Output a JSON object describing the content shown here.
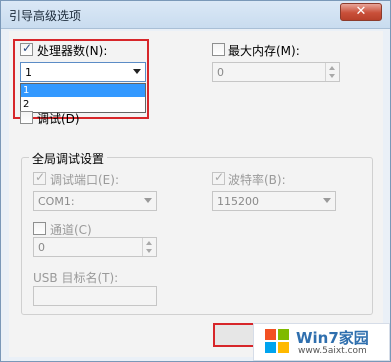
{
  "window": {
    "title": "引导高级选项",
    "close_label": "✕"
  },
  "processors": {
    "checkbox_checked": true,
    "label": "处理器数(N):",
    "selected_value": "1",
    "options": [
      "1",
      "2"
    ],
    "highlighted_option": "1"
  },
  "max_memory": {
    "checkbox_checked": false,
    "label": "最大内存(M):",
    "value": "0"
  },
  "debug": {
    "checkbox_checked": false,
    "label": "调试(D)"
  },
  "global_debug": {
    "legend": "全局调试设置",
    "debug_port": {
      "checkbox_checked": true,
      "label": "调试端口(E):",
      "value": "COM1:"
    },
    "baud_rate": {
      "checkbox_checked": true,
      "label": "波特率(B):",
      "value": "115200"
    },
    "channel": {
      "checkbox_checked": false,
      "label": "通道(C)",
      "value": "0"
    },
    "usb_target": {
      "label": "USB 目标名(T):",
      "value": ""
    }
  },
  "watermark": {
    "brand": "Win7家园",
    "url": "www.5aixt.com"
  }
}
